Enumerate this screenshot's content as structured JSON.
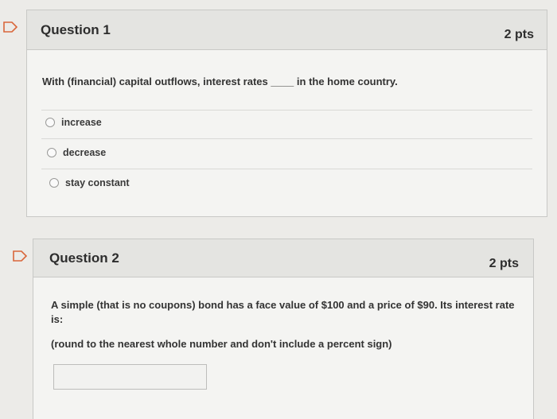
{
  "question1": {
    "title": "Question 1",
    "points": "2 pts",
    "text": "With (financial) capital outflows, interest rates ____ in the home country.",
    "answers": [
      {
        "label": "increase"
      },
      {
        "label": "decrease"
      },
      {
        "label": "stay constant"
      }
    ]
  },
  "question2": {
    "title": "Question 2",
    "points": "2 pts",
    "text": "A simple (that is no coupons) bond has a face value of $100 and a price of $90. Its interest rate is:",
    "instruction": "(round to the nearest whole number and don't include a percent sign)",
    "answer_value": ""
  },
  "icons": {
    "flag_icon": "flag-icon"
  },
  "colors": {
    "flag_color": "#d9663a",
    "header_background": "#e4e4e1",
    "card_background": "#f4f4f2"
  }
}
